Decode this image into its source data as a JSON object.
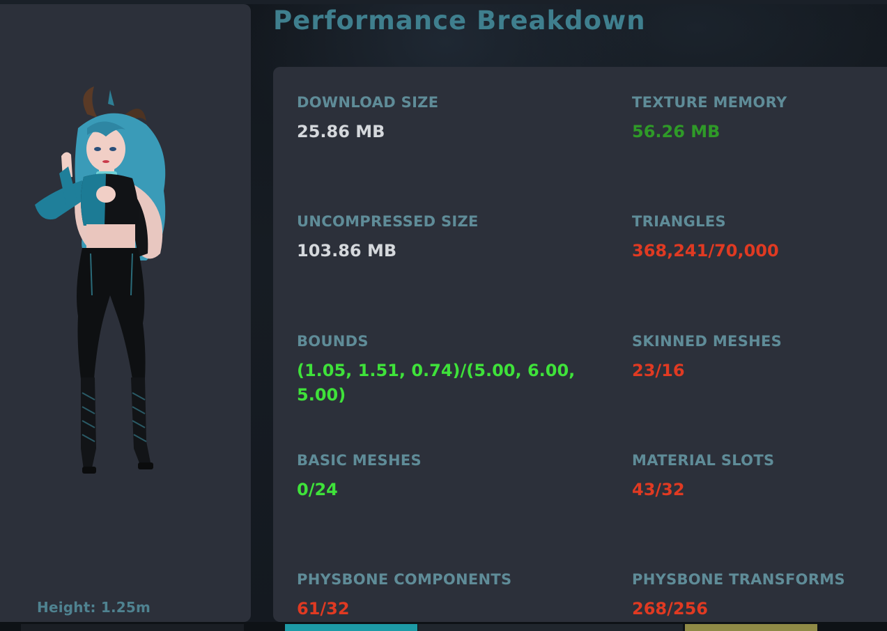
{
  "title": "Performance Breakdown",
  "avatar": {
    "height_label": "Height: 1.25m"
  },
  "stats": [
    {
      "label": "DOWNLOAD SIZE",
      "value": "25.86 MB",
      "status": "neutral"
    },
    {
      "label": "TEXTURE MEMORY",
      "value": "56.26 MB",
      "status": "good"
    },
    {
      "label": "UNCOMPRESSED SIZE",
      "value": "103.86 MB",
      "status": "neutral"
    },
    {
      "label": "TRIANGLES",
      "value": "368,241/70,000",
      "status": "bad"
    },
    {
      "label": "BOUNDS",
      "value": "(1.05, 1.51, 0.74)/(5.00, 6.00, 5.00)",
      "status": "good"
    },
    {
      "label": "SKINNED MESHES",
      "value": "23/16",
      "status": "bad"
    },
    {
      "label": "BASIC MESHES",
      "value": "0/24",
      "status": "good"
    },
    {
      "label": "MATERIAL SLOTS",
      "value": "43/32",
      "status": "bad"
    },
    {
      "label": "PHYSBONE COMPONENTS",
      "value": "61/32",
      "status": "bad"
    },
    {
      "label": "PHYSBONE TRANSFORMS",
      "value": "268/256",
      "status": "bad"
    }
  ],
  "colors": {
    "label": "#5f8c98",
    "neutral": "#d5d8dc",
    "good_dark": "#2f9a28",
    "good": "#3fe23a",
    "bad": "#e03a22",
    "title": "#3f7f8e"
  }
}
